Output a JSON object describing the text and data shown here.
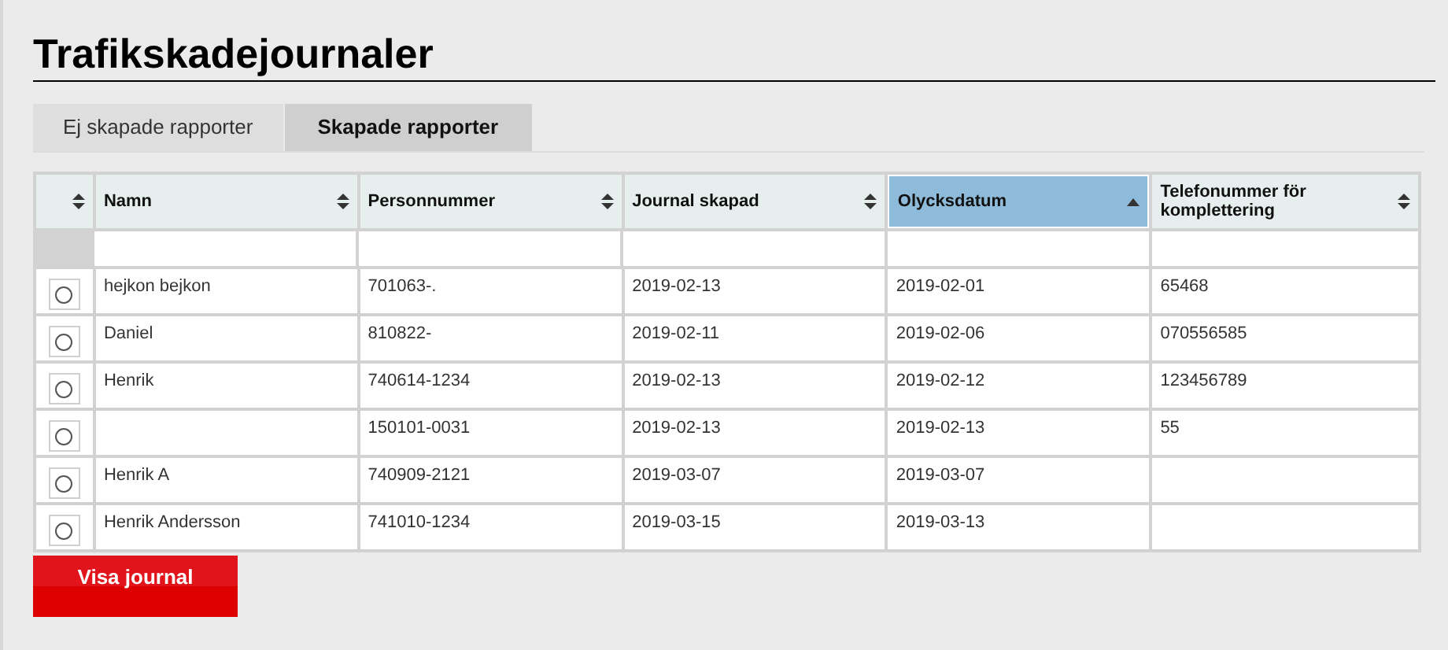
{
  "page_title": "Trafikskadejournaler",
  "tabs": [
    {
      "label": "Ej skapade rapporter",
      "selected": false
    },
    {
      "label": "Skapade rapporter",
      "selected": true
    }
  ],
  "table": {
    "select_column": {
      "sorted": false
    },
    "columns": [
      {
        "label": "Namn",
        "sorted": false
      },
      {
        "label": "Personnummer",
        "sorted": false
      },
      {
        "label": "Journal skapad",
        "sorted": false
      },
      {
        "label": "Olycksdatum",
        "sorted": true
      },
      {
        "label": "Telefonummer för komplettering",
        "sorted": false
      }
    ],
    "rows": [
      {
        "selected": false,
        "cells": [
          "hejkon bejkon",
          "701063-.",
          "2019-02-13",
          "2019-02-01",
          "65468"
        ]
      },
      {
        "selected": false,
        "cells": [
          "Daniel",
          "810822-",
          "2019-02-11",
          "2019-02-06",
          "070556585"
        ]
      },
      {
        "selected": false,
        "cells": [
          "Henrik",
          "740614-1234",
          "2019-02-13",
          "2019-02-12",
          "123456789"
        ]
      },
      {
        "selected": false,
        "cells": [
          "",
          "150101-0031",
          "2019-02-13",
          "2019-02-13",
          "55"
        ]
      },
      {
        "selected": false,
        "cells": [
          "Henrik A",
          "740909-2121",
          "2019-03-07",
          "2019-03-07",
          ""
        ]
      },
      {
        "selected": false,
        "cells": [
          "Henrik Andersson",
          "741010-1234",
          "2019-03-15",
          "2019-03-13",
          ""
        ]
      }
    ]
  },
  "button": "Visa journal"
}
